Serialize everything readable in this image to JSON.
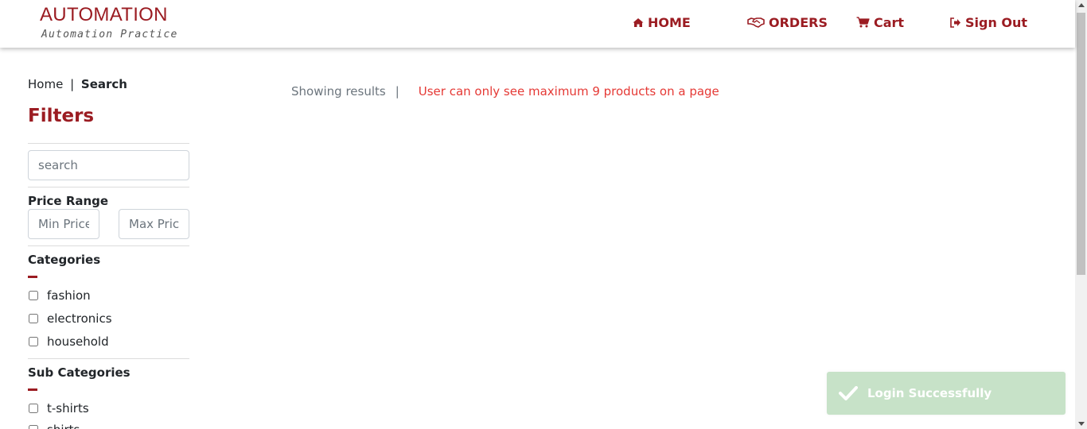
{
  "brand": {
    "title": "AUTOMATION",
    "subtitle": "Automation Practice"
  },
  "nav": {
    "home": "HOME",
    "orders": "ORDERS",
    "cart": "Cart",
    "sign_out": "Sign Out"
  },
  "breadcrumb": {
    "home": "Home",
    "separator": "|",
    "current": "Search"
  },
  "filters": {
    "title": "Filters",
    "search_placeholder": "search",
    "price_range_label": "Price Range",
    "min_price_placeholder": "Min Price",
    "max_price_placeholder": "Max Price",
    "categories_label": "Categories",
    "categories": [
      "fashion",
      "electronics",
      "household"
    ],
    "sub_categories_label": "Sub Categories",
    "sub_categories": [
      "t-shirts",
      "shirts"
    ]
  },
  "results": {
    "label": "Showing results",
    "separator": "|",
    "note": "User can only see maximum 9 products on a page"
  },
  "toast": {
    "message": "Login Successfully"
  },
  "colors": {
    "brand": "#9b1c22",
    "note": "#e53935",
    "toast_bg": "#c7e2c8"
  }
}
